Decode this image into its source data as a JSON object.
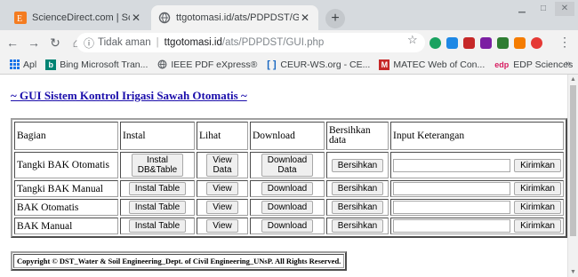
{
  "browser": {
    "tabs": [
      {
        "title": "ScienceDirect.com | Science, hea",
        "icon": "elsevier-icon",
        "active": false
      },
      {
        "title": "ttgotomasi.id/ats/PDPDST/GUI.p",
        "icon": "globe-icon",
        "active": true
      }
    ],
    "new_tab": "+",
    "address": {
      "security_text": "Tidak aman",
      "host": "ttgotomasi.id",
      "path": "/ats/PDPDST/GUI.php"
    },
    "bookmarks": [
      {
        "label": "Apl",
        "icon": "apps-grid-icon"
      },
      {
        "label": "Bing Microsoft Tran...",
        "icon": "bing-icon"
      },
      {
        "label": "IEEE PDF eXpress®",
        "icon": "globe-icon"
      },
      {
        "label": "CEUR-WS.org - CE...",
        "icon": "ceur-icon"
      },
      {
        "label": "MATEC Web of Con...",
        "icon": "matec-icon"
      },
      {
        "label": "EDP Sciences",
        "icon": "edp-icon"
      }
    ],
    "bookmarks_more": "»"
  },
  "page": {
    "title": "~ GUI Sistem Kontrol Irigasi Sawah Otomatis ~",
    "table": {
      "headers": [
        "Bagian",
        "Instal",
        "Lihat",
        "Download",
        "Bersihkan data",
        "Input Keterangan"
      ],
      "rows": [
        {
          "bagian": "Tangki BAK Otomatis",
          "instal": "Instal\nDB&Table",
          "lihat": "View\nData",
          "download": "Download\nData",
          "bersihkan": "Bersihkan",
          "kirim": "Kirimkan"
        },
        {
          "bagian": "Tangki BAK Manual",
          "instal": "Instal Table",
          "lihat": "View",
          "download": "Download",
          "bersihkan": "Bersihkan",
          "kirim": "Kirimkan"
        },
        {
          "bagian": "BAK Otomatis",
          "instal": "Instal Table",
          "lihat": "View",
          "download": "Download",
          "bersihkan": "Bersihkan",
          "kirim": "Kirimkan"
        },
        {
          "bagian": "BAK Manual",
          "instal": "Instal Table",
          "lihat": "View",
          "download": "Download",
          "bersihkan": "Bersihkan",
          "kirim": "Kirimkan"
        }
      ]
    },
    "footer": "Copyright © DST_Water & Soil Engineering_Dept. of Civil Engineering_UNsP. All Rights Reserved."
  },
  "colors": {
    "link": "#1a0dab",
    "tabstrip": "#d6dade",
    "toolbar": "#f2f2f2"
  }
}
